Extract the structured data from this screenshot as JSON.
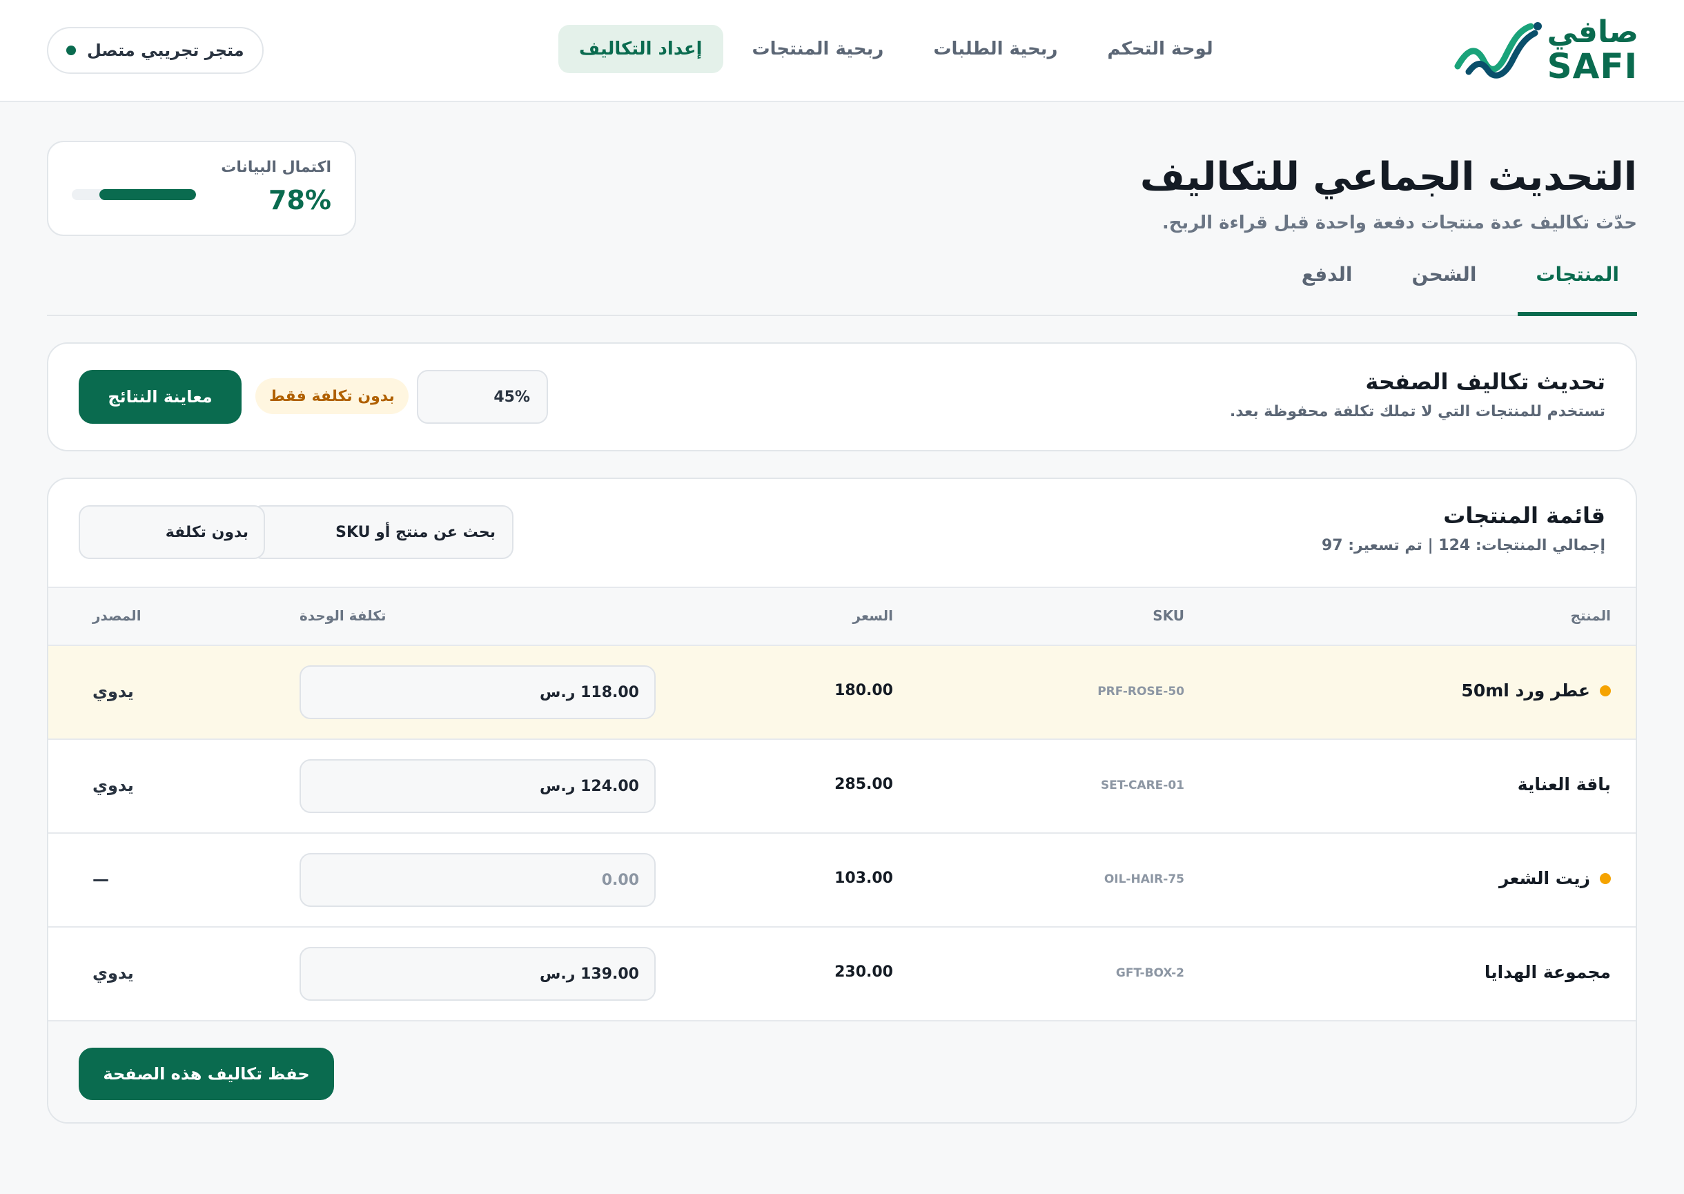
{
  "brand": {
    "name_ar": "صافي",
    "name_en": "SAFI"
  },
  "nav": [
    {
      "label": "لوحة التحكم",
      "active": false
    },
    {
      "label": "ربحية الطلبات",
      "active": false
    },
    {
      "label": "ربحية المنتجات",
      "active": false
    },
    {
      "label": "إعداد التكاليف",
      "active": true
    }
  ],
  "store": {
    "label": "متجر تجريبي متصل",
    "status_color": "#0a6b4f"
  },
  "page": {
    "title": "التحديث الجماعي للتكاليف",
    "subtitle": "حدّث تكاليف عدة منتجات دفعة واحدة قبل قراءة الربح."
  },
  "completion": {
    "label": "اكتمال البيانات",
    "value_text": "78%",
    "fraction": 0.78
  },
  "tabs": [
    {
      "label": "المنتجات",
      "active": true
    },
    {
      "label": "الشحن",
      "active": false
    },
    {
      "label": "الدفع",
      "active": false
    }
  ],
  "bulk": {
    "title": "تحديث تكاليف الصفحة",
    "subtitle": "تستخدم للمنتجات التي لا تملك تكلفة محفوظة بعد.",
    "percent_value": "45%",
    "badge": "بدون تكلفة فقط",
    "preview_label": "معاينة النتائج"
  },
  "list": {
    "title": "قائمة المنتجات",
    "summary": "إجمالي المنتجات: 124 | تم تسعير: 97",
    "search_placeholder": "بحث عن منتج أو SKU",
    "filter_value": "بدون تكلفة",
    "columns": {
      "product": "المنتج",
      "sku": "SKU",
      "price": "السعر",
      "unit_cost": "تكلفة الوحدة",
      "source": "المصدر"
    },
    "rows": [
      {
        "name": "عطر ورد 50ml",
        "sku": "PRF-ROSE-50",
        "price": "180.00",
        "cost": "118.00 ر.س",
        "source": "يدوي",
        "warning": true,
        "highlight": true
      },
      {
        "name": "باقة العناية",
        "sku": "SET-CARE-01",
        "price": "285.00",
        "cost": "124.00 ر.س",
        "source": "يدوي",
        "warning": false,
        "highlight": false
      },
      {
        "name": "زيت الشعر",
        "sku": "OIL-HAIR-75",
        "price": "103.00",
        "cost": "0.00",
        "source": "—",
        "warning": true,
        "highlight": false,
        "cost_empty": true
      },
      {
        "name": "مجموعة الهدايا",
        "sku": "GFT-BOX-2",
        "price": "230.00",
        "cost": "139.00 ر.س",
        "source": "يدوي",
        "warning": false,
        "highlight": false
      }
    ],
    "save_label": "حفظ تكاليف هذه الصفحة"
  },
  "colors": {
    "primary": "#0a6b4f",
    "warning": "#f5a300",
    "highlight_row": "#fdf9e8"
  }
}
